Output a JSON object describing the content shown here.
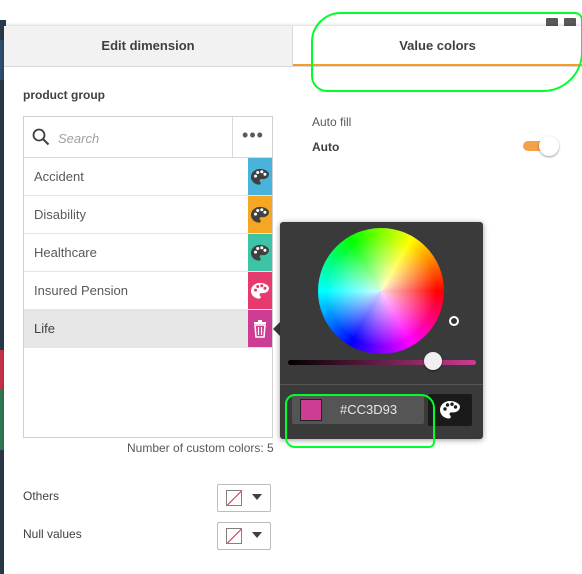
{
  "tabs": {
    "edit_dimension": "Edit dimension",
    "value_colors": "Value colors"
  },
  "dimension": {
    "title": "product group"
  },
  "search": {
    "placeholder": "Search"
  },
  "more_menu_label": "•••",
  "values": [
    {
      "label": "Accident",
      "color": "#4ab3dc",
      "icon": "palette-icon"
    },
    {
      "label": "Disability",
      "color": "#f5a623",
      "icon": "palette-icon"
    },
    {
      "label": "Healthcare",
      "color": "#3ec3a6",
      "icon": "palette-icon"
    },
    {
      "label": "Insured Pension",
      "color": "#e6396e",
      "icon": "palette-icon"
    },
    {
      "label": "Life",
      "color": "#cc3d93",
      "icon": "trash-icon",
      "selected": true
    }
  ],
  "custom_colors_count_text": "Number of custom colors: 5",
  "others": {
    "label": "Others",
    "value": "no color"
  },
  "null_values": {
    "label": "Null values",
    "value": "no color"
  },
  "auto_fill": {
    "label": "Auto fill",
    "value_text": "Auto",
    "enabled": true
  },
  "color_picker": {
    "hex": "#CC3D93",
    "selected_color": "#cc3d93"
  },
  "colors": {
    "accent": "#f59c28",
    "annotation_highlight": "#00ff2a",
    "picker_background": "#3a3a3a"
  }
}
